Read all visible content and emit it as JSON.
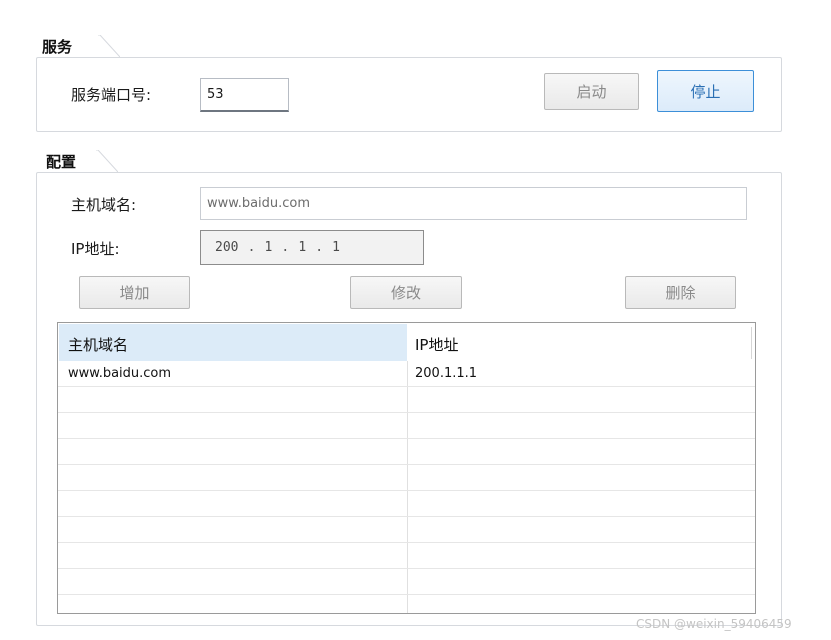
{
  "service": {
    "title": "服务",
    "port_label": "服务端口号:",
    "port_value": "53",
    "start_button": "启动",
    "stop_button": "停止"
  },
  "config": {
    "title": "配置",
    "host_label": "主机域名:",
    "host_value": "www.baidu.com",
    "ip_label": "IP地址:",
    "ip_octets": [
      "200",
      "1",
      "1",
      "1"
    ],
    "ip_separator": ".",
    "add_button": "增加",
    "edit_button": "修改",
    "delete_button": "删除"
  },
  "table": {
    "columns": [
      "主机域名",
      "IP地址"
    ],
    "rows": [
      [
        "www.baidu.com",
        "200.1.1.1"
      ]
    ]
  },
  "watermark": "CSDN @weixin_59406459",
  "colors": {
    "header_highlight": "#dcebf8",
    "primary_border": "#3c8fd8"
  }
}
